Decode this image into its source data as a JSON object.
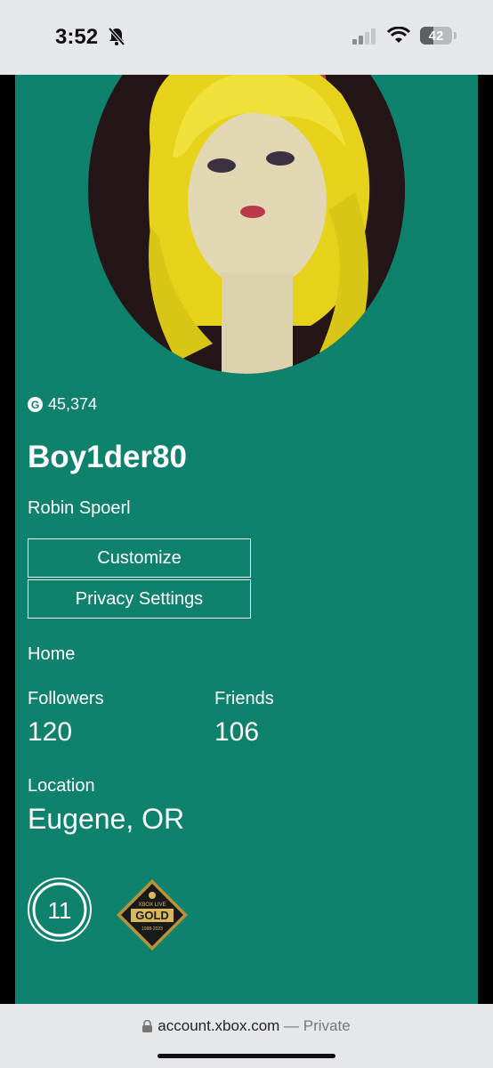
{
  "status_bar": {
    "time": "3:52",
    "battery": "42",
    "battery_level": 0.42
  },
  "profile": {
    "gamerscore": "45,374",
    "gamerscore_icon_letter": "G",
    "gamertag": "Boy1der80",
    "real_name": "Robin Spoerl"
  },
  "actions": {
    "customize_label": "Customize",
    "privacy_label": "Privacy Settings"
  },
  "nav": {
    "home_label": "Home"
  },
  "stats": {
    "followers_label": "Followers",
    "followers_value": "120",
    "friends_label": "Friends",
    "friends_value": "106"
  },
  "location": {
    "label": "Location",
    "value": "Eugene, OR"
  },
  "badges": {
    "reputation_level": "11",
    "gold_top": "XBOX LIVE",
    "gold_main": "GOLD",
    "gold_bottom": "1998-2023"
  },
  "browser": {
    "domain": "account.xbox.com",
    "mode": "— Private"
  },
  "colors": {
    "panel": "#0f826d",
    "background": "#000000",
    "chrome": "#e6e7ea"
  }
}
